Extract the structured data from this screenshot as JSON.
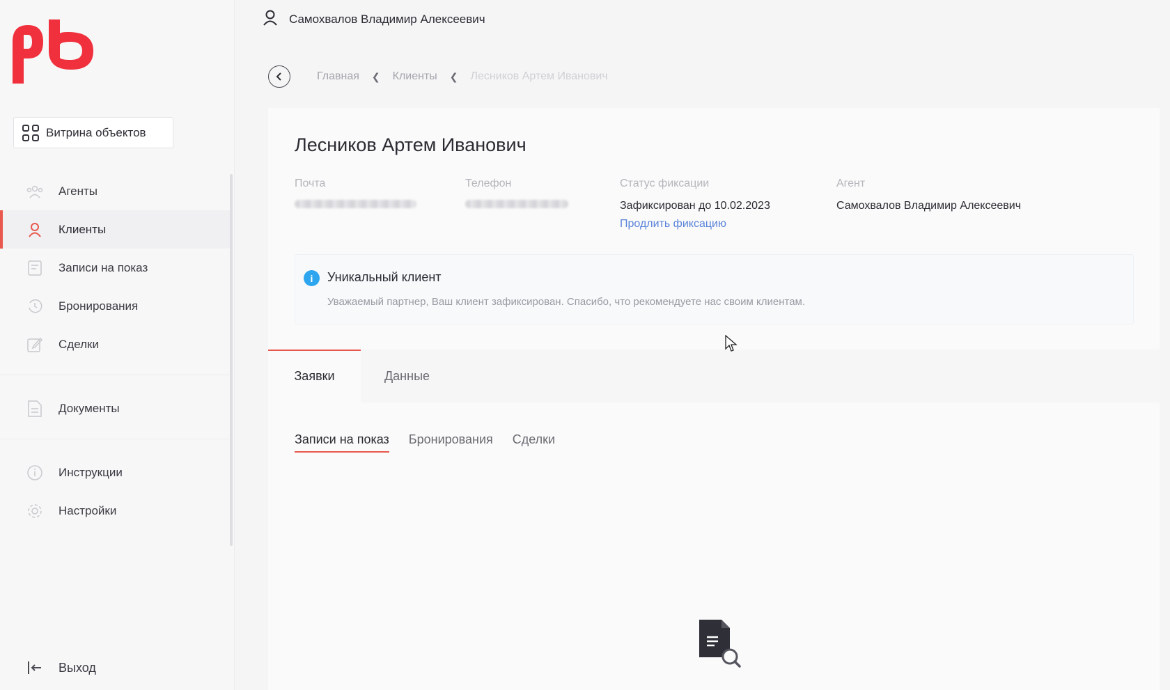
{
  "header": {
    "user_name": "Самохвалов Владимир Алексеевич"
  },
  "sidebar": {
    "showcase_label": "Витрина объектов",
    "items": [
      {
        "label": "Агенты",
        "icon": "agents-icon"
      },
      {
        "label": "Клиенты",
        "icon": "client-icon",
        "active": true
      },
      {
        "label": "Записи на показ",
        "icon": "showing-icon"
      },
      {
        "label": "Бронирования",
        "icon": "booking-icon"
      },
      {
        "label": "Сделки",
        "icon": "deal-icon"
      },
      {
        "label": "Документы",
        "icon": "document-icon"
      },
      {
        "label": "Инструкции",
        "icon": "info-icon"
      },
      {
        "label": "Настройки",
        "icon": "gear-icon"
      }
    ],
    "logout_label": "Выход"
  },
  "breadcrumb": {
    "home": "Главная",
    "clients": "Клиенты",
    "current": "Лесников Артем Иванович"
  },
  "client": {
    "name": "Лесников Артем Иванович",
    "email_label": "Почта",
    "phone_label": "Телефон",
    "status_label": "Статус фиксации",
    "status_value": "Зафиксирован до 10.02.2023",
    "extend_link": "Продлить фиксацию",
    "agent_label": "Агент",
    "agent_value": "Самохвалов Владимир Алексеевич"
  },
  "alert": {
    "title": "Уникальный клиент",
    "text": "Уважаемый партнер, Ваш клиент зафиксирован. Спасибо, что рекомендуете нас своим клиентам."
  },
  "tabs": [
    {
      "label": "Заявки",
      "active": true
    },
    {
      "label": "Данные",
      "active": false
    }
  ],
  "subtabs": [
    {
      "label": "Записи на показ",
      "active": true
    },
    {
      "label": "Бронирования",
      "active": false
    },
    {
      "label": "Сделки",
      "active": false
    }
  ],
  "colors": {
    "accent": "#e8584e",
    "link": "#5a83d9",
    "info": "#2ea6ef",
    "brand": "#f0303c"
  }
}
